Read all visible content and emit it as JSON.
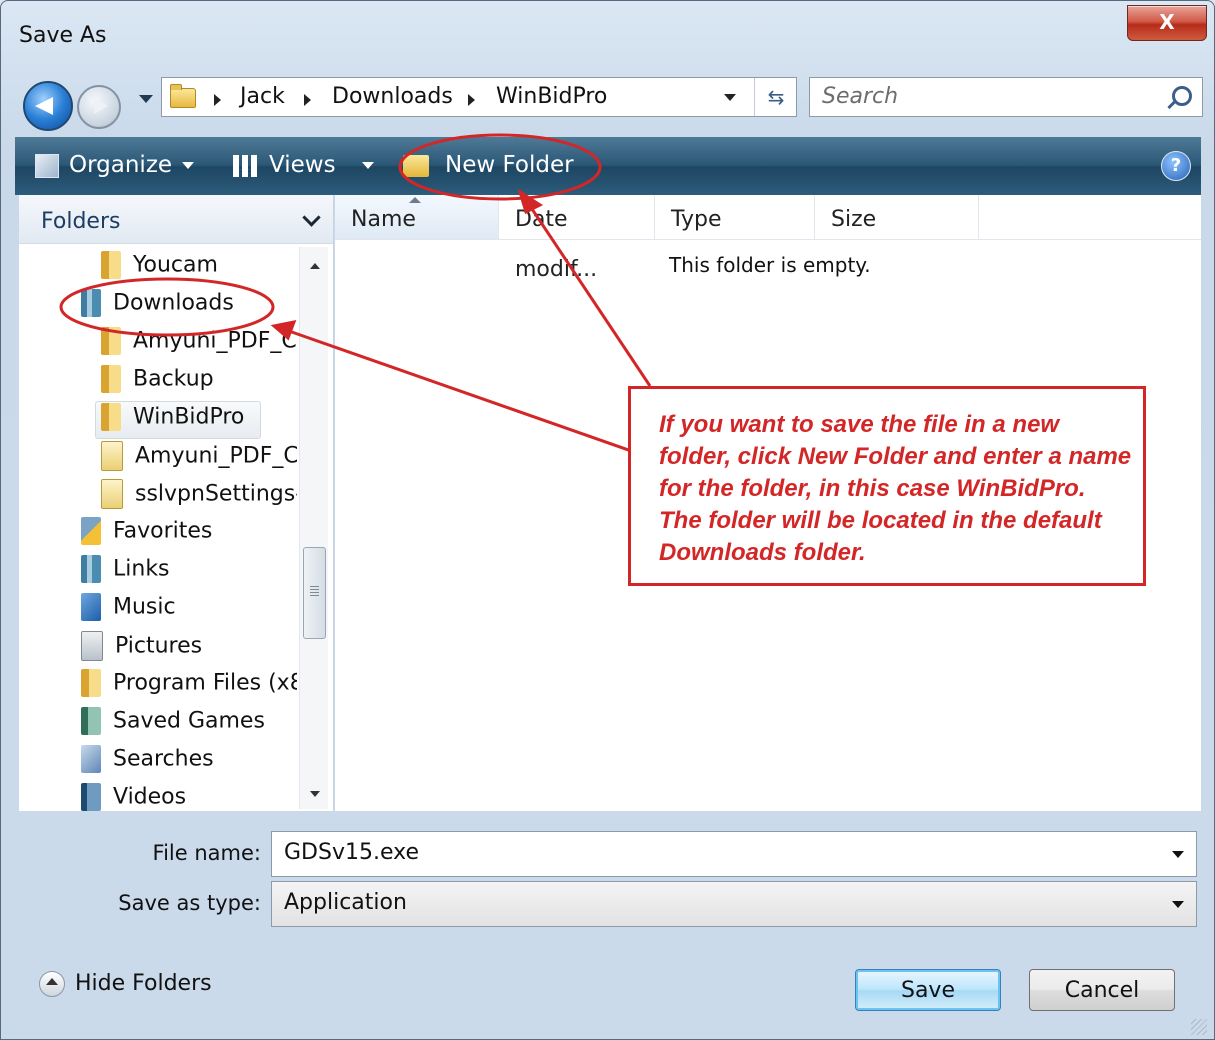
{
  "window": {
    "title": "Save As",
    "close_label": "X"
  },
  "nav": {
    "breadcrumbs": [
      "Jack",
      "Downloads",
      "WinBidPro"
    ],
    "search_placeholder": "Search"
  },
  "toolbar": {
    "organize": "Organize",
    "views": "Views",
    "new_folder": "New Folder",
    "help": "?"
  },
  "folders_pane": {
    "header": "Folders",
    "items": [
      {
        "label": "Youcam",
        "icon": "folder-icon"
      },
      {
        "label": "Downloads",
        "icon": "library-icon"
      },
      {
        "label": "Amyuni_PDF_C",
        "icon": "folder-icon"
      },
      {
        "label": "Backup",
        "icon": "folder-icon"
      },
      {
        "label": "WinBidPro",
        "icon": "folder-icon"
      },
      {
        "label": "Amyuni_PDF_C",
        "icon": "installer-icon"
      },
      {
        "label": "sslvpnSettings-",
        "icon": "installer-icon"
      },
      {
        "label": "Favorites",
        "icon": "favorites-icon"
      },
      {
        "label": "Links",
        "icon": "library-icon"
      },
      {
        "label": "Music",
        "icon": "music-icon"
      },
      {
        "label": "Pictures",
        "icon": "pictures-icon"
      },
      {
        "label": "Program Files (x8",
        "icon": "folder-icon"
      },
      {
        "label": "Saved Games",
        "icon": "saved-games-icon"
      },
      {
        "label": "Searches",
        "icon": "searches-icon"
      },
      {
        "label": "Videos",
        "icon": "videos-icon"
      }
    ]
  },
  "file_list": {
    "columns": [
      "Name",
      "Date modif...",
      "Type",
      "Size"
    ],
    "empty_message": "This folder is empty."
  },
  "form": {
    "file_name_label": "File name:",
    "file_name_value": "GDSv15.exe",
    "save_type_label": "Save as type:",
    "save_type_value": "Application"
  },
  "footer": {
    "hide_folders": "Hide Folders",
    "save": "Save",
    "cancel": "Cancel"
  },
  "annotation": {
    "callout_text": "If you want to save the file in a new folder, click New Folder and enter a name for the folder, in this case WinBidPro. The folder will be located in the default Downloads folder.",
    "color": "#d32627"
  }
}
